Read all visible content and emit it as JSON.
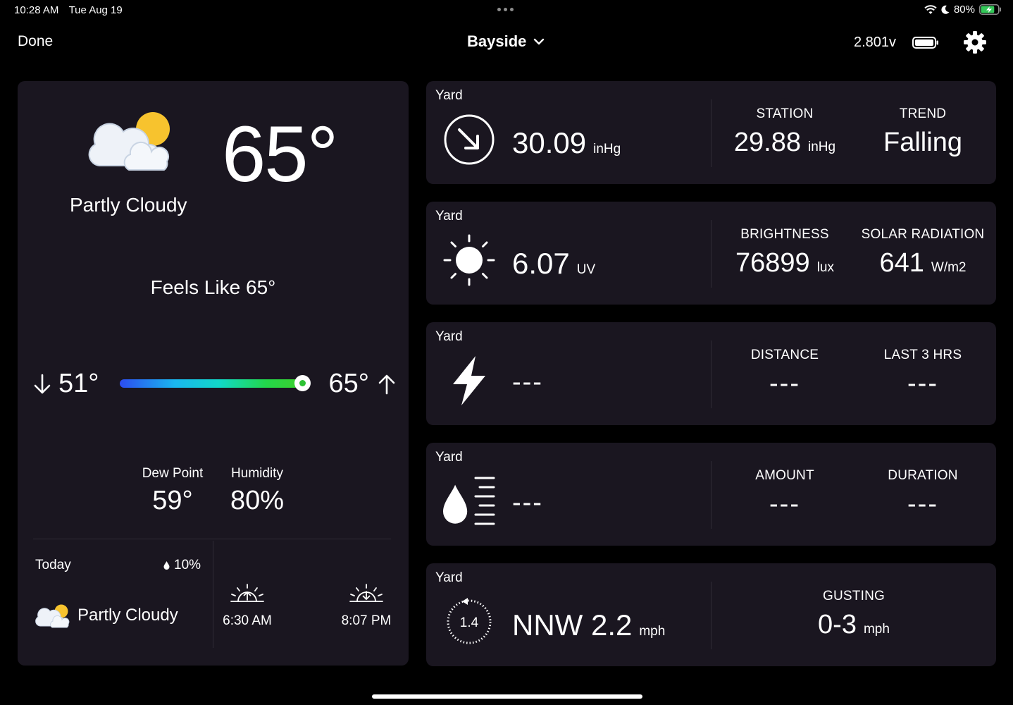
{
  "status": {
    "time": "10:28 AM",
    "date": "Tue Aug 19",
    "battery_pct": "80%",
    "battery_level": 0.8
  },
  "header": {
    "done_label": "Done",
    "station_name": "Bayside",
    "voltage": "2.801v"
  },
  "current": {
    "condition": "Partly Cloudy",
    "temperature": "65°",
    "feels_like": "Feels Like 65°",
    "low": "51°",
    "high": "65°",
    "range_fraction": 1.0,
    "dew_point_label": "Dew Point",
    "dew_point": "59°",
    "humidity_label": "Humidity",
    "humidity": "80%"
  },
  "today": {
    "label": "Today",
    "precip_chance": "10%",
    "condition": "Partly Cloudy",
    "sunrise": "6:30 AM",
    "sunset": "8:07 PM"
  },
  "cards": {
    "pressure": {
      "location": "Yard",
      "value": "30.09",
      "unit": "inHg",
      "station_label": "STATION",
      "station_value": "29.88",
      "station_unit": "inHg",
      "trend_label": "TREND",
      "trend_value": "Falling"
    },
    "solar": {
      "location": "Yard",
      "value": "6.07",
      "unit": "UV",
      "brightness_label": "BRIGHTNESS",
      "brightness_value": "76899",
      "brightness_unit": "lux",
      "radiation_label": "SOLAR RADIATION",
      "radiation_value": "641",
      "radiation_unit": "W/m2"
    },
    "lightning": {
      "location": "Yard",
      "value": "---",
      "distance_label": "DISTANCE",
      "distance_value": "---",
      "last3_label": "LAST 3 HRS",
      "last3_value": "---"
    },
    "rain": {
      "location": "Yard",
      "value": "---",
      "amount_label": "AMOUNT",
      "amount_value": "---",
      "duration_label": "DURATION",
      "duration_value": "---"
    },
    "wind": {
      "location": "Yard",
      "value": "NNW 2.2",
      "unit": "mph",
      "dial_value": "1.4",
      "gusting_label": "GUSTING",
      "gusting_value": "0-3",
      "gusting_unit": "mph"
    }
  },
  "colors": {
    "background": "#000000",
    "panel": "#1a1620",
    "battery_green": "#34c759",
    "sun": "#f7c32e"
  },
  "icons": [
    "wifi-icon",
    "moon-icon",
    "battery-charging-icon",
    "chevron-down-icon",
    "battery-icon",
    "gear-icon",
    "partly-cloudy-icon",
    "arrow-down-icon",
    "arrow-up-icon",
    "raindrop-icon",
    "sunrise-icon",
    "sunset-icon",
    "pressure-falling-icon",
    "sun-icon",
    "lightning-icon",
    "rain-icon",
    "wind-dial-icon"
  ]
}
